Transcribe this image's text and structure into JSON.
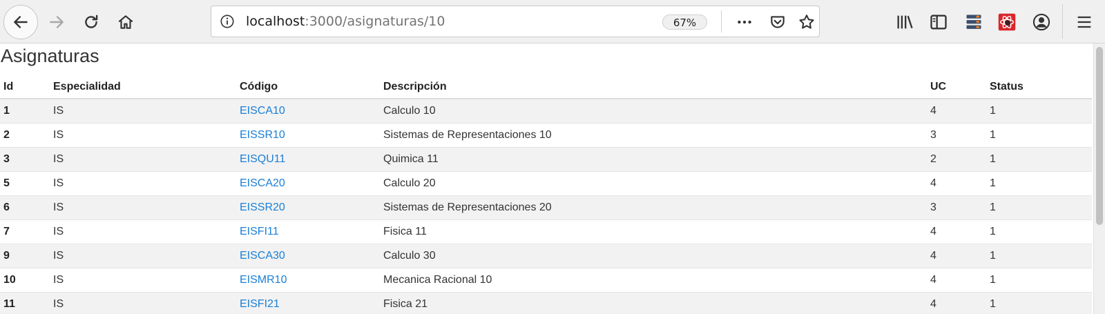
{
  "browser": {
    "url_host": "localhost",
    "url_path": ":3000/asignaturas/10",
    "zoom": "67%",
    "icons": [
      "back-icon",
      "forward-icon",
      "reload-icon",
      "home-icon",
      "info-icon",
      "more-icon",
      "pocket-icon",
      "star-icon",
      "library-icon",
      "sidebar-icon",
      "extension-icon",
      "extension-icon",
      "account-icon",
      "menu-icon"
    ]
  },
  "page": {
    "title": "Asignaturas",
    "headers": {
      "id": "Id",
      "especialidad": "Especialidad",
      "codigo": "Código",
      "descripcion": "Descripción",
      "uc": "UC",
      "status": "Status"
    },
    "rows": [
      {
        "id": "1",
        "especialidad": "IS",
        "codigo": "EISCA10",
        "descripcion": "Calculo 10",
        "uc": "4",
        "status": "1"
      },
      {
        "id": "2",
        "especialidad": "IS",
        "codigo": "EISSR10",
        "descripcion": "Sistemas de Representaciones 10",
        "uc": "3",
        "status": "1"
      },
      {
        "id": "3",
        "especialidad": "IS",
        "codigo": "EISQU11",
        "descripcion": "Quimica 11",
        "uc": "2",
        "status": "1"
      },
      {
        "id": "5",
        "especialidad": "IS",
        "codigo": "EISCA20",
        "descripcion": "Calculo 20",
        "uc": "4",
        "status": "1"
      },
      {
        "id": "6",
        "especialidad": "IS",
        "codigo": "EISSR20",
        "descripcion": "Sistemas de Representaciones 20",
        "uc": "3",
        "status": "1"
      },
      {
        "id": "7",
        "especialidad": "IS",
        "codigo": "EISFI11",
        "descripcion": "Fisica 11",
        "uc": "4",
        "status": "1"
      },
      {
        "id": "9",
        "especialidad": "IS",
        "codigo": "EISCA30",
        "descripcion": "Calculo 30",
        "uc": "4",
        "status": "1"
      },
      {
        "id": "10",
        "especialidad": "IS",
        "codigo": "EISMR10",
        "descripcion": "Mecanica Racional 10",
        "uc": "4",
        "status": "1"
      },
      {
        "id": "11",
        "especialidad": "IS",
        "codigo": "EISFI21",
        "descripcion": "Fisica 21",
        "uc": "4",
        "status": "1"
      }
    ]
  },
  "colors": {
    "link": "#1a7fd6",
    "stripe": "#f2f2f2",
    "toolbar": "#f0f0f0",
    "ext_red": "#d9262b"
  }
}
